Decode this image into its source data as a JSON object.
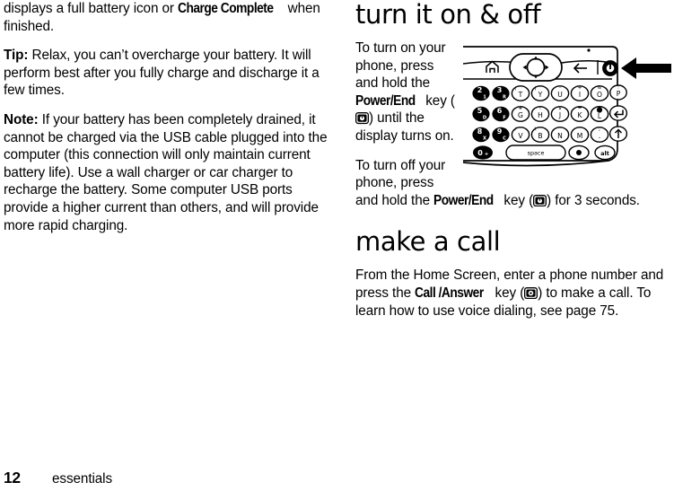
{
  "page": {
    "number": "12",
    "chapter_footer": "essentials"
  },
  "left_column": {
    "paragraphs": [
      {
        "id": "p-continued",
        "segments": [
          {
            "type": "text",
            "text": "displays a full battery icon or "
          },
          {
            "type": "bold",
            "text": "Charge Complete"
          },
          {
            "type": "text",
            "text": " when finished."
          }
        ],
        "plain": "displays a full battery icon or Charge Complete when finished."
      },
      {
        "id": "p-tip",
        "segments": [
          {
            "type": "bold",
            "text": "Tip:"
          },
          {
            "type": "text",
            "text": " Relax, you can’t overcharge your battery. It will perform best after you fully charge and discharge it a few times."
          }
        ],
        "plain": "Tip: Relax, you can’t overcharge your battery. It will perform best after you fully charge and discharge it a few times."
      },
      {
        "id": "p-note",
        "segments": [
          {
            "type": "bold",
            "text": "Note:"
          },
          {
            "type": "text",
            "text": " If your battery has been completely drained, it cannot be charged via the USB cable plugged into the computer (this connection will only maintain current battery life). Use a wall charger or car charger to recharge the battery. Some computer USB ports provide a higher current than others, and will provide more rapid charging."
          }
        ],
        "plain": "Note: If your battery has been completely drained, it cannot be charged via the USB cable plugged into the computer (this connection will only maintain current battery life). Use a wall charger or car charger to recharge the battery. Some computer USB ports provide a higher current than others, and will provide more rapid charging."
      }
    ]
  },
  "right_column": {
    "heading_turn_on_off": "turn it on & off",
    "heading_make_a_call": "make a call",
    "para_turn_on": {
      "before_bold": "To turn on your phone, press and hold the ",
      "bold": "Power/End",
      "after_bold_1": " key (",
      "icon": "power-end-key-icon",
      "after_icon": ") until the display turns on."
    },
    "para_turn_off": {
      "before_bold": "To turn off your phone, press and hold the ",
      "bold": "Power/End",
      "after_bold_1": " key (",
      "icon": "power-end-key-icon",
      "after_icon": ") for 3 seconds."
    },
    "para_make_call": {
      "before_bold": "From the Home Screen, enter a phone number and press the ",
      "bold": "Call /Answer",
      "after_bold_1": " key (",
      "icon": "call-answer-key-icon",
      "after_icon": ") to make a call. To learn how to use voice dialing, see page 75."
    }
  },
  "figure": {
    "name": "phone-keypad-diagram",
    "caption": "",
    "callout_arrow": "points to Power/End key",
    "nav_keys": {
      "home": "home-icon",
      "dpad": "navigation-dpad",
      "back": "back-arrow-icon",
      "power": "power-end-key"
    },
    "keyboard_rows": [
      [
        "2 1",
        "3 R",
        "T",
        "Y",
        "U",
        "I",
        "O",
        "P"
      ],
      [
        "5 D",
        "6 F",
        "G",
        "H",
        "J",
        "K",
        "L",
        "enter"
      ],
      [
        "8 X",
        "9 C",
        "V",
        "B",
        "N",
        "M",
        ".",
        "shift-up"
      ],
      [
        "0 +",
        "space",
        "sym",
        "alt"
      ]
    ],
    "space_label": "space"
  },
  "colors": {
    "ink": "#000000",
    "paper": "#ffffff",
    "line": "#1a1a1a"
  }
}
